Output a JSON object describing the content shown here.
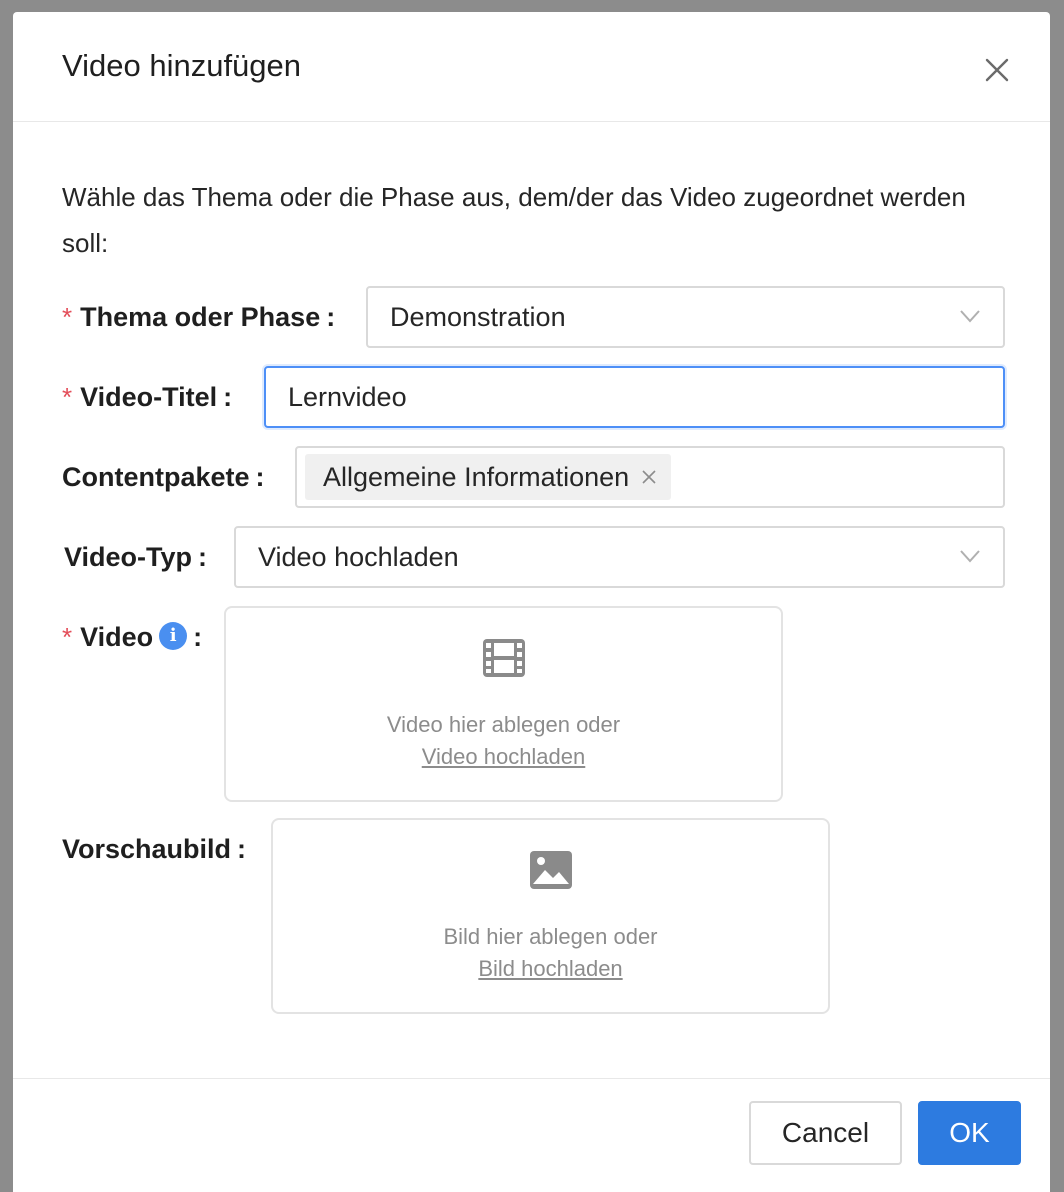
{
  "modal": {
    "title": "Video hinzufügen",
    "close_icon": "close-icon"
  },
  "intro": "Wähle das Thema oder die Phase aus, dem/der das Video zugeordnet werden soll:",
  "form": {
    "required_marker": "*",
    "colon": ":",
    "topic": {
      "label": "Thema oder Phase",
      "value": "Demonstration",
      "required": true
    },
    "title": {
      "label": "Video-Titel",
      "value": "Lernvideo",
      "required": true
    },
    "content_packages": {
      "label": "Contentpakete",
      "tags": [
        "Allgemeine Informationen"
      ]
    },
    "video_type": {
      "label": "Video-Typ",
      "value": "Video hochladen"
    },
    "video": {
      "label": "Video",
      "required": true,
      "info_icon": "info-icon",
      "dropzone_icon": "film-icon",
      "drop_text": "Video hier ablegen oder",
      "upload_link": "Video hochladen"
    },
    "thumbnail": {
      "label": "Vorschaubild",
      "dropzone_icon": "image-icon",
      "drop_text": "Bild hier ablegen oder",
      "upload_link": "Bild hochladen"
    }
  },
  "footer": {
    "cancel_label": "Cancel",
    "ok_label": "OK"
  },
  "colors": {
    "primary": "#2d7be0",
    "focus_border": "#4d8ff7",
    "required": "#e34d59",
    "info": "#4a8ff0"
  }
}
